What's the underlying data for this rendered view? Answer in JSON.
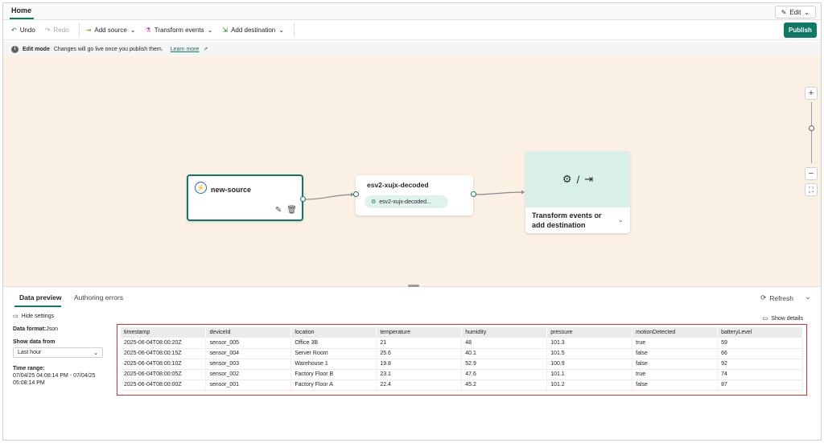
{
  "tabs": {
    "home": "Home",
    "edit": "Edit"
  },
  "toolbar": {
    "undo": "Undo",
    "redo": "Redo",
    "add_source": "Add source",
    "transform_events": "Transform events",
    "add_destination": "Add destination",
    "publish": "Publish"
  },
  "infobar": {
    "title": "Edit mode",
    "message": "Changes will go live once you publish them.",
    "link": "Learn more"
  },
  "canvas": {
    "source_node": {
      "title": "new-source"
    },
    "stream_node": {
      "title": "esv2-xujx-decoded",
      "chip": "esv2-xujx-decoded..."
    },
    "destination_node": {
      "text": "Transform events or add destination"
    }
  },
  "bottom_panel": {
    "tabs": [
      "Data preview",
      "Authoring errors"
    ],
    "refresh": "Refresh",
    "hide_settings": "Hide settings",
    "show_details": "Show details",
    "data_format_label": "Data format:",
    "data_format_value": "Json",
    "show_data_from_label": "Show data from",
    "show_data_from_value": "Last hour",
    "time_range_label": "Time range:",
    "time_range_value": "07/04/25 04:08:14 PM - 07/04/25 05:08:14 PM"
  },
  "table": {
    "columns": [
      "timestamp",
      "deviceId",
      "location",
      "temperature",
      "humidity",
      "pressure",
      "motionDetected",
      "batteryLevel"
    ],
    "rows": [
      [
        "2025-06-04T08:00:20Z",
        "sensor_005",
        "Office 3B",
        "21",
        "48",
        "101.3",
        "true",
        "59"
      ],
      [
        "2025-06-04T08:00:15Z",
        "sensor_004",
        "Server Room",
        "25.6",
        "40.1",
        "101.5",
        "false",
        "66"
      ],
      [
        "2025-06-04T08:00:10Z",
        "sensor_003",
        "Warehouse 1",
        "19.8",
        "52.9",
        "100.9",
        "false",
        "92"
      ],
      [
        "2025-06-04T08:00:05Z",
        "sensor_002",
        "Factory Floor B",
        "23.1",
        "47.6",
        "101.1",
        "true",
        "74"
      ],
      [
        "2025-06-04T08:00:00Z",
        "sensor_001",
        "Factory Floor A",
        "22.4",
        "45.2",
        "101.2",
        "false",
        "87"
      ]
    ]
  },
  "colors": {
    "accent": "#117865",
    "canvas": "#faf1e4",
    "highlight": "#d13438"
  }
}
